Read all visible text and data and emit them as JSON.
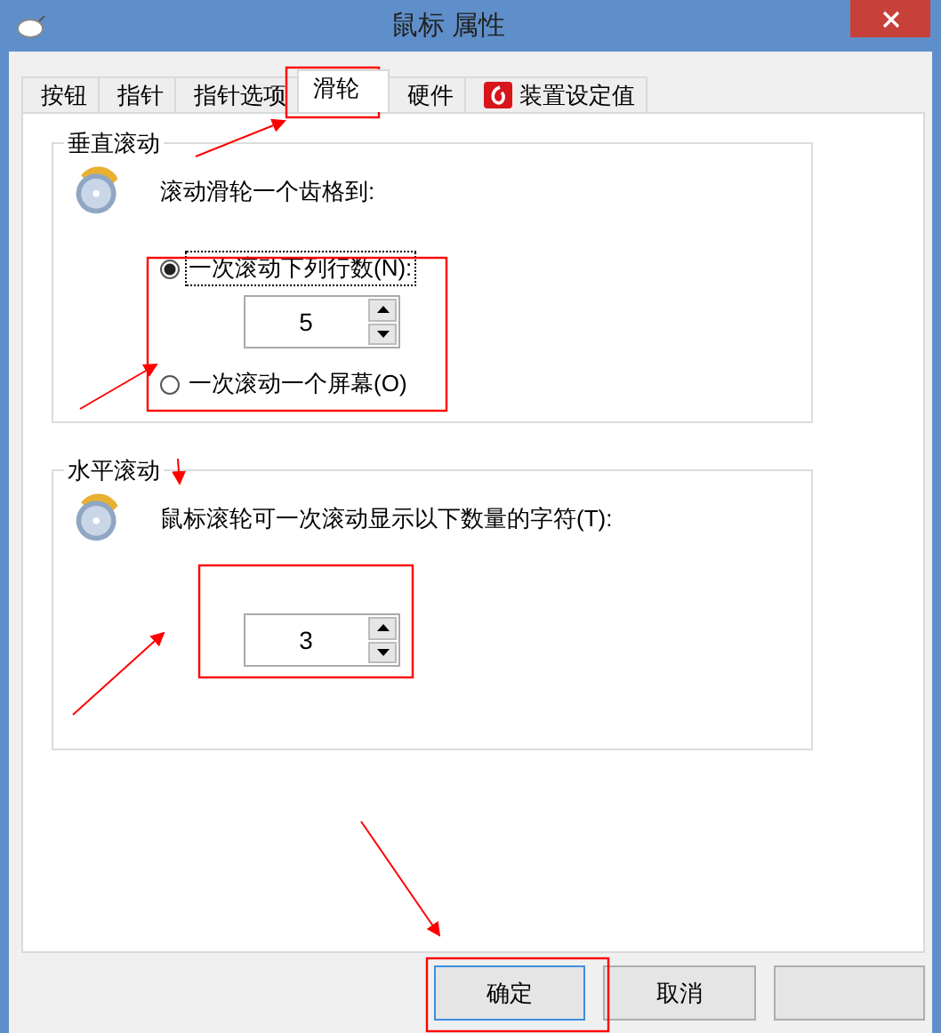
{
  "window": {
    "title": "鼠标 属性"
  },
  "tabs": [
    {
      "label": "按钮",
      "selected": false,
      "kind": "plain"
    },
    {
      "label": "指针",
      "selected": false,
      "kind": "plain"
    },
    {
      "label": "指针选项",
      "selected": false,
      "kind": "plain"
    },
    {
      "label": "滑轮",
      "selected": true,
      "kind": "plain"
    },
    {
      "label": "硬件",
      "selected": false,
      "kind": "plain"
    },
    {
      "label": "装置设定值",
      "selected": false,
      "kind": "device"
    }
  ],
  "vertical_scroll": {
    "title": "垂直滚动",
    "prompt": "滚动滑轮一个齿格到:",
    "options": [
      {
        "label": "一次滚动下列行数(N):",
        "selected": true,
        "kind": "lines"
      },
      {
        "label": "一次滚动一个屏幕(O)",
        "selected": false,
        "kind": "screen"
      }
    ],
    "lines": {
      "value": "5"
    }
  },
  "horizontal_scroll": {
    "title": "水平滚动",
    "prompt": "鼠标滚轮可一次滚动显示以下数量的字符(T):",
    "chars": {
      "value": "3"
    }
  },
  "buttons": [
    {
      "label": "确定",
      "default": true
    },
    {
      "label": "取消",
      "default": false
    }
  ]
}
